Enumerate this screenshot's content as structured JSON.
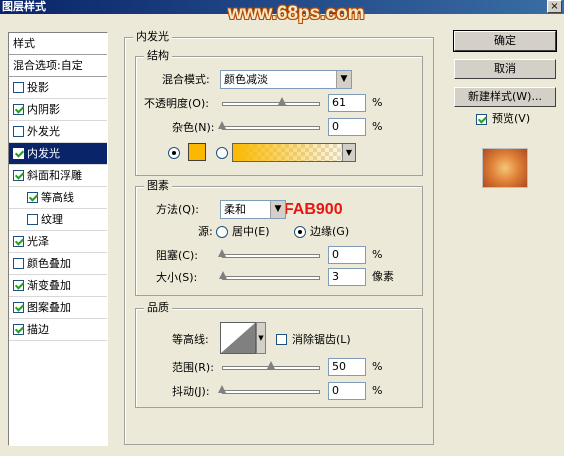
{
  "window": {
    "title": "图层样式",
    "watermark": "www.68ps.com",
    "close_glyph": "×"
  },
  "style_list": {
    "header": "样式",
    "blend_options": "混合选项:自定",
    "items": [
      {
        "label": "投影",
        "checked": false
      },
      {
        "label": "内阴影",
        "checked": true
      },
      {
        "label": "外发光",
        "checked": false
      },
      {
        "label": "内发光",
        "checked": true,
        "active": true
      },
      {
        "label": "斜面和浮雕",
        "checked": true
      },
      {
        "label": "等高线",
        "checked": true,
        "sub": true
      },
      {
        "label": "纹理",
        "checked": false,
        "sub": true
      },
      {
        "label": "光泽",
        "checked": true
      },
      {
        "label": "颜色叠加",
        "checked": false
      },
      {
        "label": "渐变叠加",
        "checked": true
      },
      {
        "label": "图案叠加",
        "checked": true
      },
      {
        "label": "描边",
        "checked": true
      }
    ]
  },
  "inner_glow": {
    "title": "内发光",
    "structure": {
      "title": "结构",
      "blend_mode_label": "混合模式:",
      "blend_mode_value": "颜色减淡",
      "opacity_label": "不透明度(O):",
      "opacity_value": "61",
      "opacity_unit": "%",
      "opacity_level": 0.61,
      "noise_label": "杂色(N):",
      "noise_value": "0",
      "noise_unit": "%",
      "noise_level": 0,
      "color": "#FAB900"
    },
    "elements": {
      "title": "图素",
      "annotation": "#FAB900",
      "method_label": "方法(Q):",
      "method_value": "柔和",
      "source_label": "源:",
      "source_center": "居中(E)",
      "source_edge": "边缘(G)",
      "choke_label": "阻塞(C):",
      "choke_value": "0",
      "choke_unit": "%",
      "choke_level": 0,
      "size_label": "大小(S):",
      "size_value": "3",
      "size_unit": "像素",
      "size_level": 0.012
    },
    "quality": {
      "title": "品质",
      "contour_label": "等高线:",
      "antialias_label": "消除锯齿(L)",
      "range_label": "范围(R):",
      "range_value": "50",
      "range_unit": "%",
      "range_level": 0.5,
      "jitter_label": "抖动(J):",
      "jitter_value": "0",
      "jitter_unit": "%",
      "jitter_level": 0
    }
  },
  "buttons": {
    "ok": "确定",
    "cancel": "取消",
    "new_style": "新建样式(W)...",
    "preview_label": "预览(V)"
  }
}
